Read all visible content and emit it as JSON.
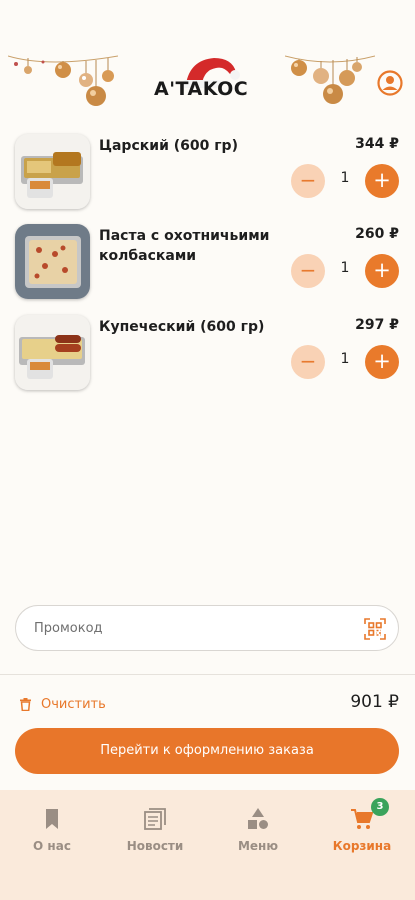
{
  "header": {
    "logo_text": "A'TAKOC",
    "profile_icon": "profile-icon"
  },
  "cart_items": [
    {
      "name": "Царский (600 гр)",
      "price": "344 ₽",
      "quantity": "1",
      "minus_label": "−",
      "plus_label": "+"
    },
    {
      "name": "Паста с охотничьими колбасками",
      "price": "260 ₽",
      "quantity": "1",
      "minus_label": "−",
      "plus_label": "+"
    },
    {
      "name": "Купеческий (600 гр)",
      "price": "297 ₽",
      "quantity": "1",
      "minus_label": "−",
      "plus_label": "+"
    }
  ],
  "promo": {
    "placeholder": "Промокод",
    "value": ""
  },
  "summary": {
    "clear_label": "Очистить",
    "total": "901 ₽"
  },
  "checkout": {
    "label": "Перейти к оформлению заказа"
  },
  "tabbar": {
    "tabs": [
      {
        "label": "О нас",
        "icon": "bookmark-icon"
      },
      {
        "label": "Новости",
        "icon": "news-icon"
      },
      {
        "label": "Меню",
        "icon": "shapes-icon"
      },
      {
        "label": "Корзина",
        "icon": "cart-icon",
        "badge": "3",
        "active": true
      }
    ]
  },
  "colors": {
    "accent": "#e8782b",
    "accent_light": "#f9d2b5",
    "tabbar_bg": "#faeadb",
    "badge": "#3aa35b"
  }
}
